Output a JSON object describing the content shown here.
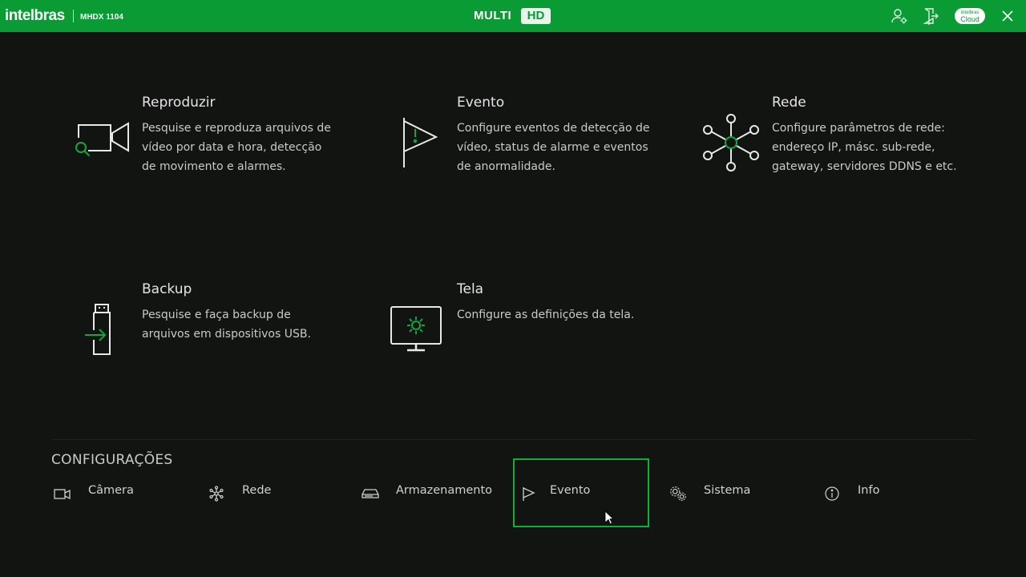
{
  "header": {
    "brand": "intelbras",
    "model": "MHDX 1104",
    "logo_multi": "MULTI",
    "logo_hd": "HD",
    "cloud_line1": "intelbras",
    "cloud_line2": "Cloud"
  },
  "cards": [
    {
      "title": "Reproduzir",
      "desc": "Pesquise e reproduza arquivos de vídeo por data e hora, detecção de movimento e alarmes."
    },
    {
      "title": "Evento",
      "desc": "Configure eventos de detecção de vídeo, status de alarme e eventos de anormalidade."
    },
    {
      "title": "Rede",
      "desc": "Configure parâmetros de rede: endereço IP, másc. sub-rede, gateway, servidores DDNS e etc."
    },
    {
      "title": "Backup",
      "desc": "Pesquise e faça backup de arquivos em dispositivos USB."
    },
    {
      "title": "Tela",
      "desc": "Configure as definições da tela."
    }
  ],
  "settings": {
    "title": "CONFIGURAÇÕES",
    "items": [
      {
        "label": "Câmera",
        "icon": "camera-icon"
      },
      {
        "label": "Rede",
        "icon": "network-icon"
      },
      {
        "label": "Armazenamento",
        "icon": "storage-icon"
      },
      {
        "label": "Evento",
        "icon": "flag-icon",
        "active": true
      },
      {
        "label": "Sistema",
        "icon": "gears-icon"
      },
      {
        "label": "Info",
        "icon": "info-icon"
      }
    ]
  },
  "colors": {
    "accent": "#0a9b35",
    "background": "#121412",
    "highlight": "#0fae3d"
  }
}
